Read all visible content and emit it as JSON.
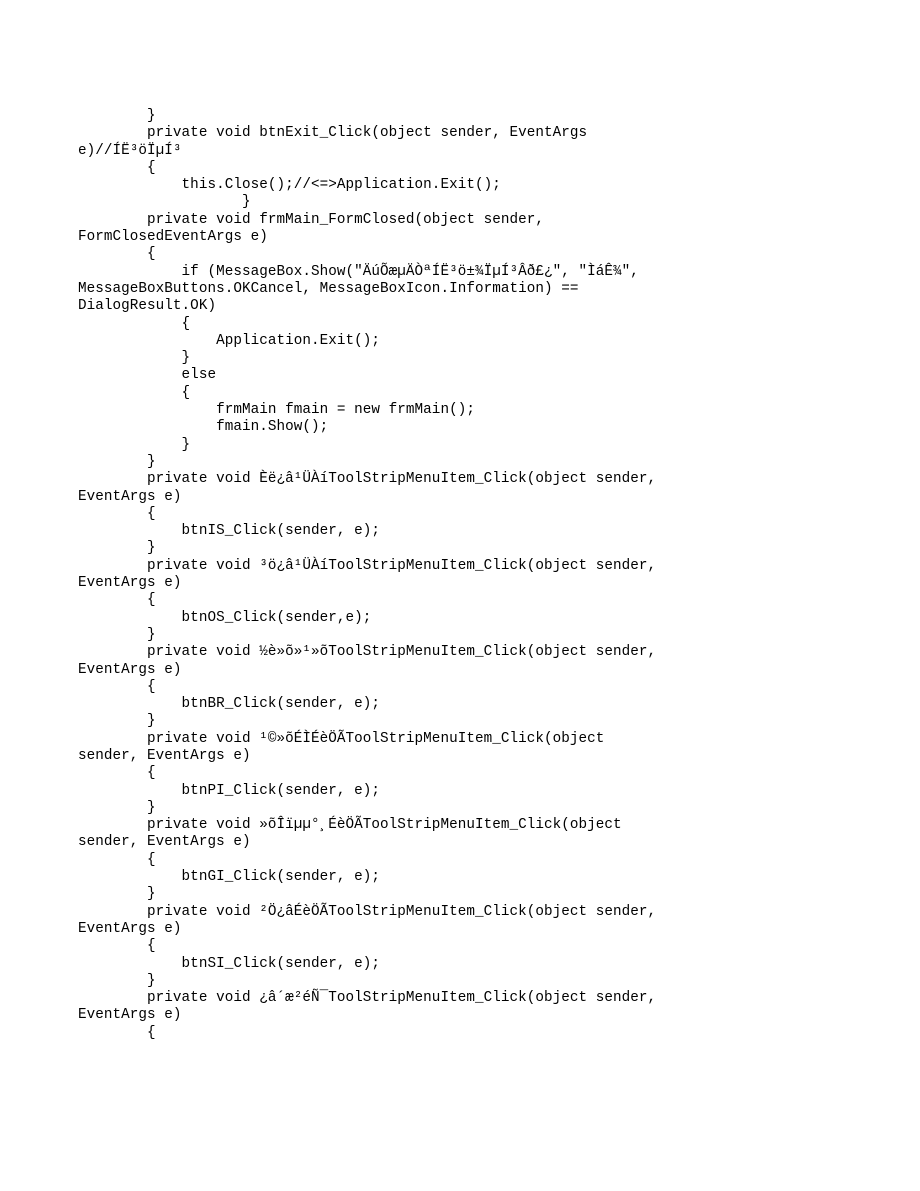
{
  "code": {
    "lines": [
      "        }",
      "        private void btnExit_Click(object sender, EventArgs ",
      "e)//ÍË³öÏµÍ³",
      "        {",
      "            this.Close();//<=>Application.Exit();",
      "                   }",
      "        private void frmMain_FormClosed(object sender, ",
      "FormClosedEventArgs e)",
      "        {",
      "            if (MessageBox.Show(\"ÄúÕæµÄÒªÍË³ö±¾ÏµÍ³Âð£¿\", \"ÌáÊ¾\", ",
      "MessageBoxButtons.OKCancel, MessageBoxIcon.Information) == ",
      "DialogResult.OK)",
      "            {",
      "                Application.Exit();",
      "            }",
      "            else",
      "            {",
      "                frmMain fmain = new frmMain();",
      "                fmain.Show();",
      "            }",
      "        }",
      "        private void Èë¿â¹ÜÀíToolStripMenuItem_Click(object sender, ",
      "EventArgs e)",
      "        {",
      "            btnIS_Click(sender, e);",
      "        }",
      "        private void ³ö¿â¹ÜÀíToolStripMenuItem_Click(object sender, ",
      "EventArgs e)",
      "        {",
      "            btnOS_Click(sender,e);",
      "        }",
      "        private void ½è»õ»¹»õToolStripMenuItem_Click(object sender, ",
      "EventArgs e)",
      "        {",
      "            btnBR_Click(sender, e);",
      "        }",
      "        private void ¹©»õÉÌÉèÖÃToolStripMenuItem_Click(object ",
      "sender, EventArgs e)",
      "        {",
      "            btnPI_Click(sender, e);",
      "        }",
      "        private void »õÎïµµ°¸ÉèÖÃToolStripMenuItem_Click(object ",
      "sender, EventArgs e)",
      "        {",
      "            btnGI_Click(sender, e);",
      "        }",
      "        private void ²Ö¿âÉèÖÃToolStripMenuItem_Click(object sender, ",
      "EventArgs e)",
      "        {",
      "            btnSI_Click(sender, e);",
      "        }",
      "        private void ¿â´æ²éÑ¯ToolStripMenuItem_Click(object sender, ",
      "EventArgs e)",
      "        {"
    ]
  }
}
